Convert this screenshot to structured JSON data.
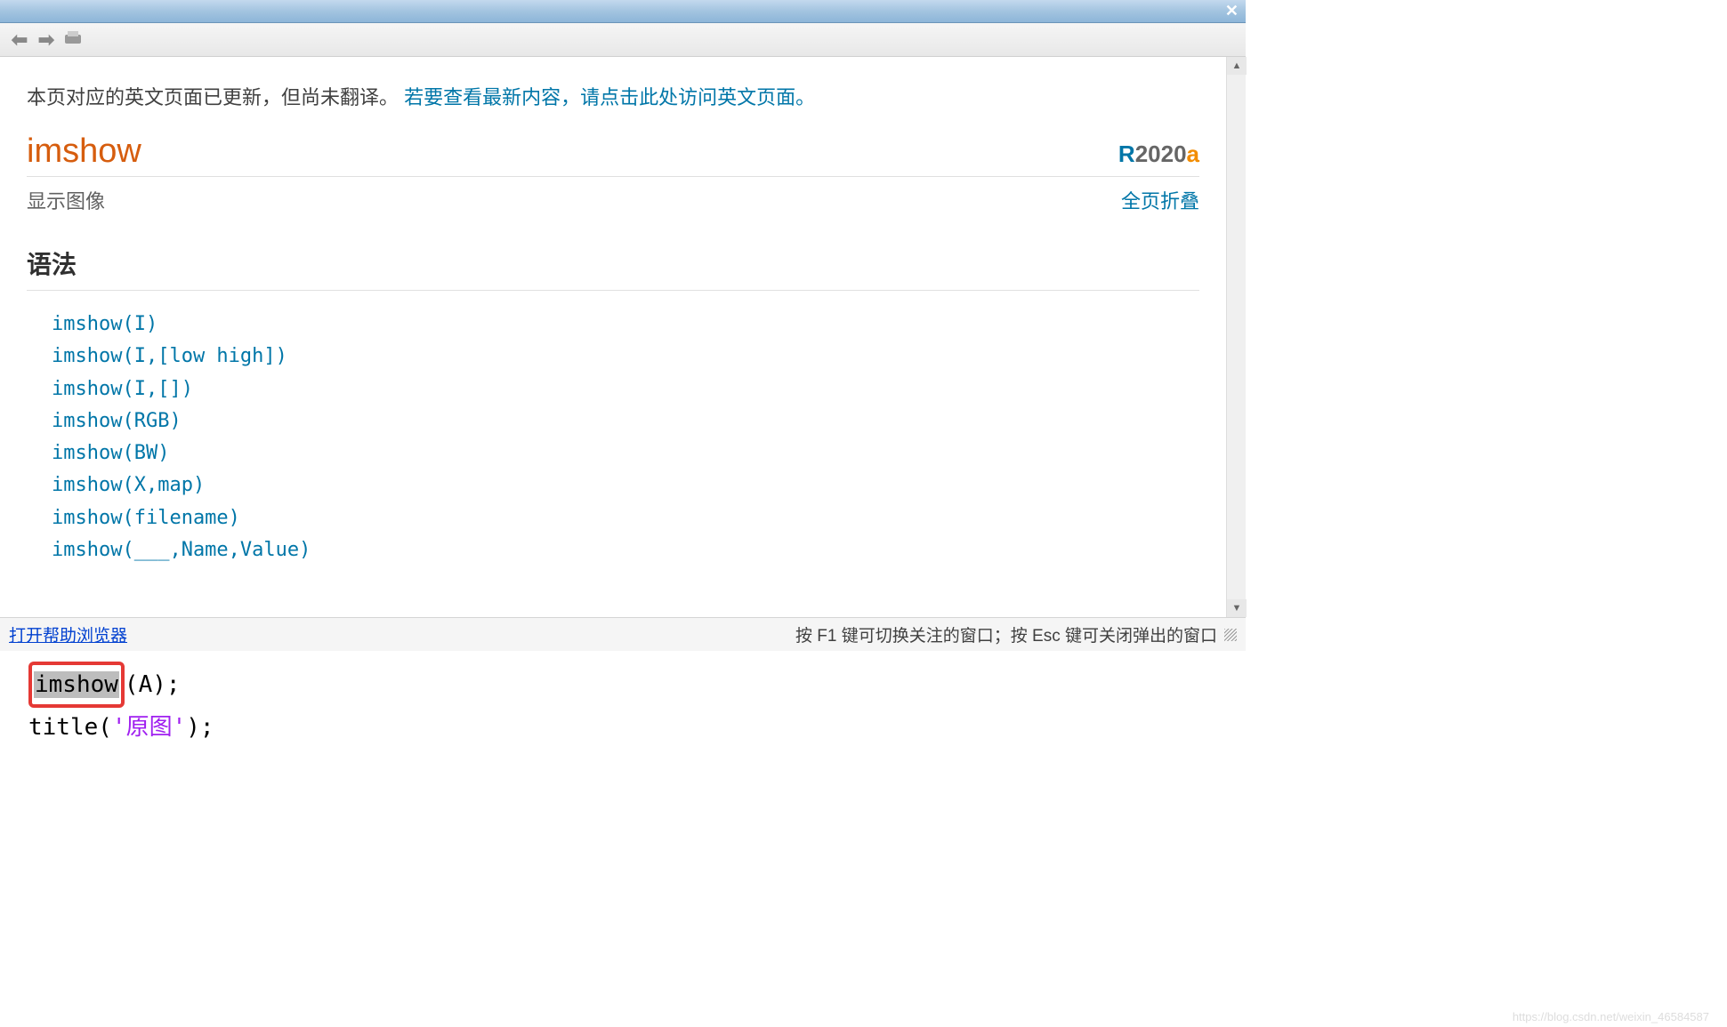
{
  "titlebar": {},
  "notice": {
    "text_static": "本页对应的英文页面已更新，但尚未翻译。 ",
    "link_text": "若要查看最新内容，请点击此处访问英文页面。"
  },
  "header": {
    "function_name": "imshow",
    "release_r": "R",
    "release_year": "2020",
    "release_a": "a",
    "subtitle": "显示图像",
    "collapse_label": "全页折叠"
  },
  "syntax": {
    "heading": "语法",
    "lines": [
      "imshow(I)",
      "imshow(I,[low high])",
      "imshow(I,[])",
      "imshow(RGB)",
      "imshow(BW)",
      "imshow(X,map)",
      "imshow(filename)",
      "imshow(___,Name,Value)"
    ]
  },
  "footer": {
    "help_link": "打开帮助浏览器",
    "hint": "按 F1 键可切换关注的窗口；按 Esc 键可关闭弹出的窗口"
  },
  "code": {
    "hl_word": "imshow",
    "line1_rest": "(A);",
    "line2_a": "title(",
    "line2_str": "'原图'",
    "line2_b": ");"
  },
  "watermark": "https://blog.csdn.net/weixin_46584587"
}
